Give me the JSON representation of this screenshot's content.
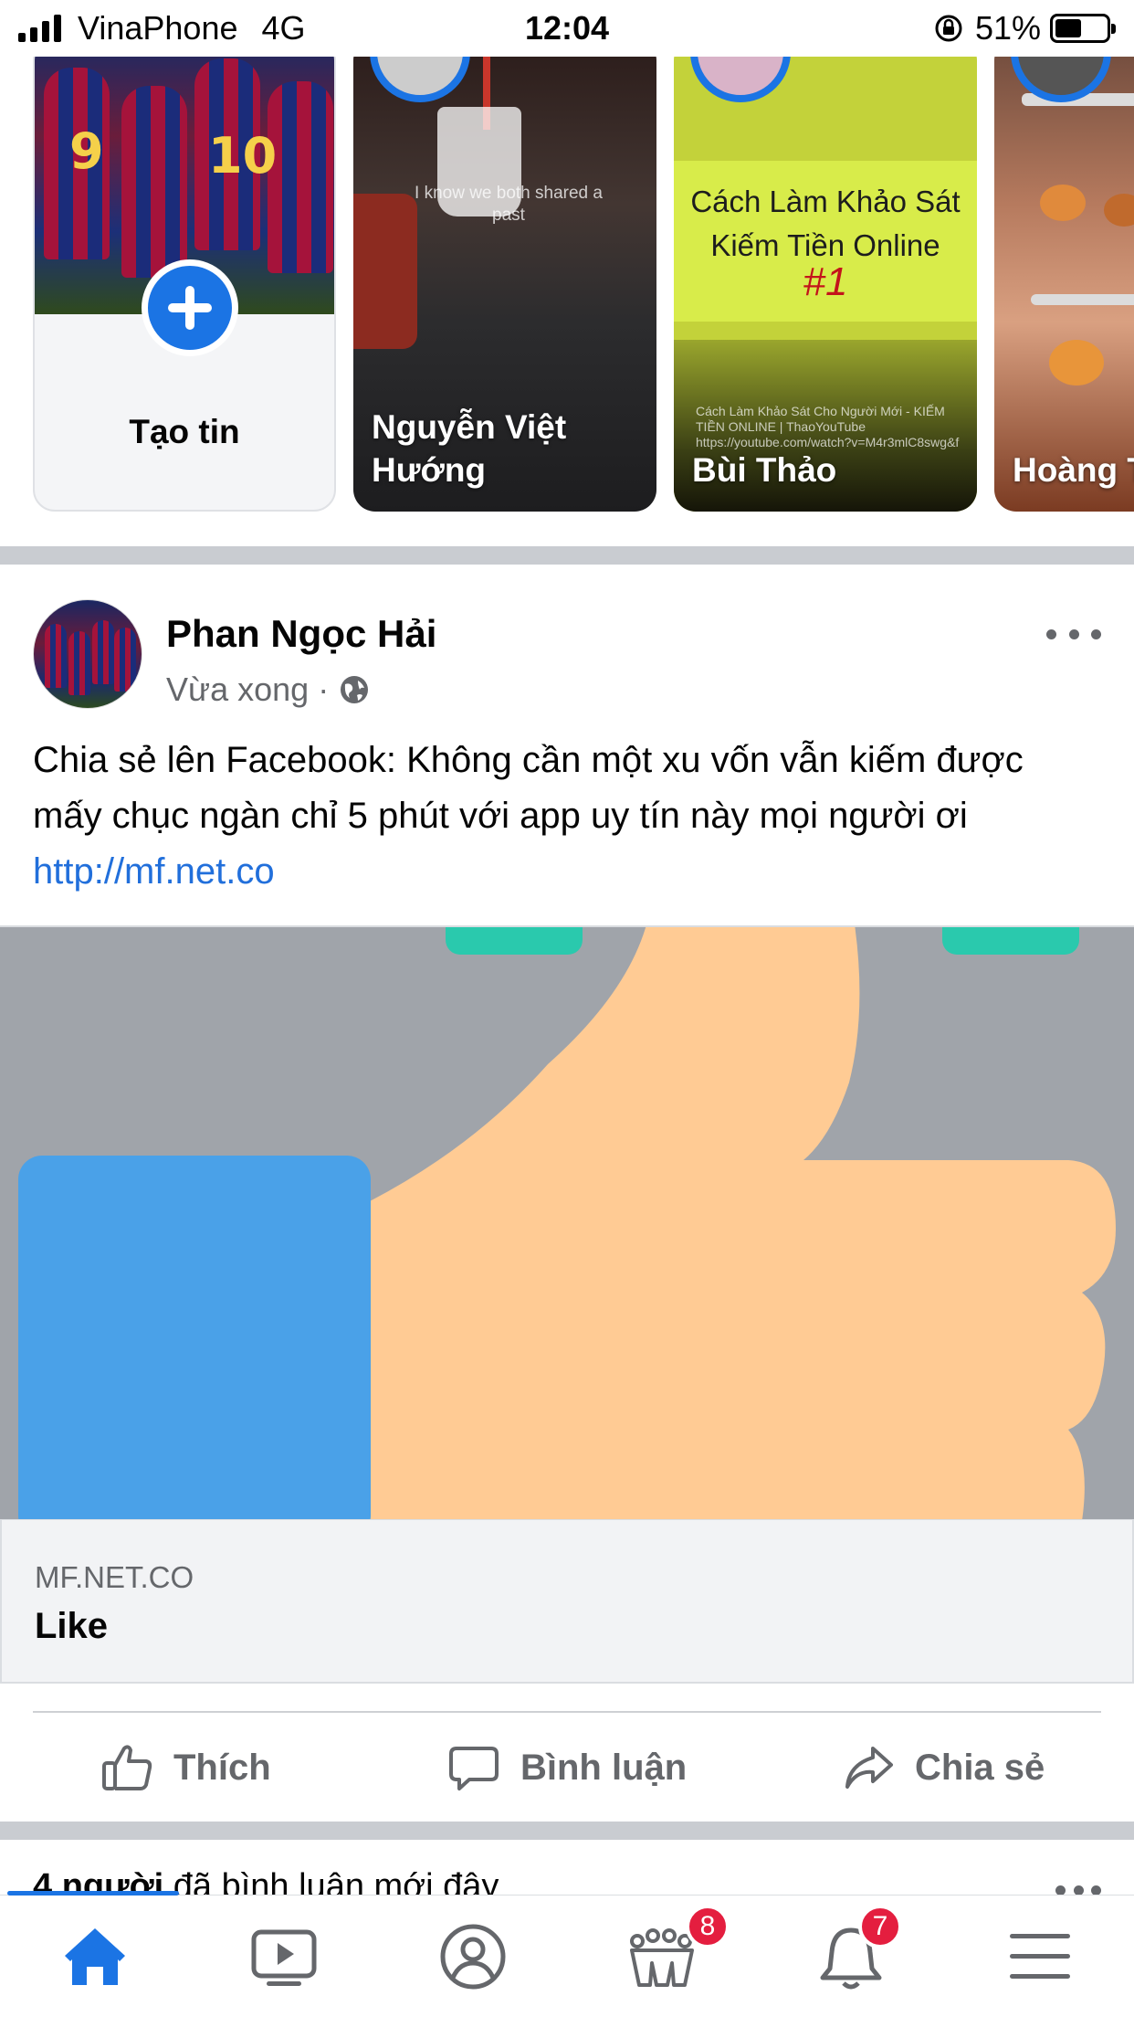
{
  "status_bar": {
    "carrier": "VinaPhone",
    "network": "4G",
    "time": "12:04",
    "battery": "51%",
    "battery_level": 0.51
  },
  "stories": {
    "create_label": "Tạo tin",
    "create_jersey_numbers": [
      "9",
      "10"
    ],
    "items": [
      {
        "name": "Nguyễn Việt Hướng",
        "overlay_text": "I know we both shared a past"
      },
      {
        "name": "Bùi Thảo",
        "title": "Cách Làm Khảo Sát Kiếm Tiền Online",
        "number": "#1",
        "small_text": "Cách Làm Khảo Sát Cho Người Mới - KIẾM TIỀN ONLINE | ThaoYouTube https://youtube.com/watch?v=M4r3mlC8swg&f"
      },
      {
        "name": "Hoàng Tuân"
      }
    ]
  },
  "post": {
    "author": "Phan Ngọc Hải",
    "time": "Vừa xong",
    "audience_icon": "globe-icon",
    "text": "Chia sẻ lên Facebook: Không cần một xu vốn vẫn kiếm được mấy chục ngàn chỉ 5 phút với app uy tín này mọi người ơi ",
    "link_text": "http://mf.net.co",
    "link_preview": {
      "domain": "MF.NET.CO",
      "title": "Like"
    },
    "actions": {
      "like": "Thích",
      "comment": "Bình luận",
      "share": "Chia sẻ"
    }
  },
  "next_post": {
    "bold": "4 người",
    "rest": " đã bình luận mới đây"
  },
  "tabbar": {
    "groups_badge": "8",
    "notifications_badge": "7"
  },
  "colors": {
    "brand_blue": "#1b74e4",
    "badge_red": "#e41e3f",
    "link_blue": "#216fdb",
    "secondary_text": "#65676b"
  }
}
